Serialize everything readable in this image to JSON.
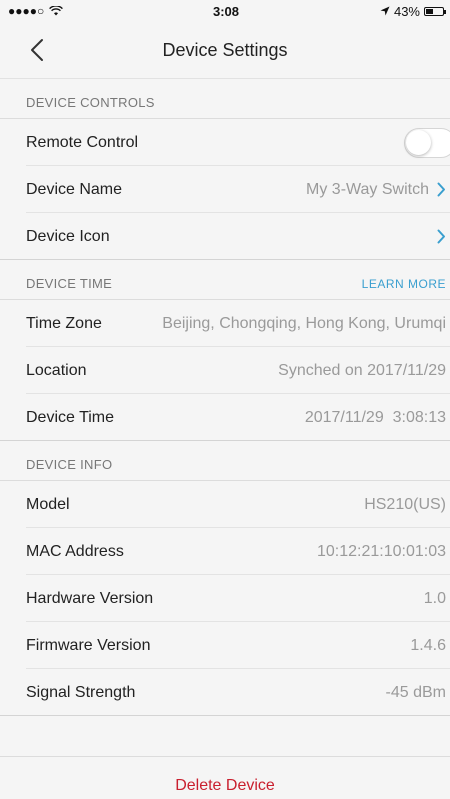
{
  "status_bar": {
    "signal": "●●●●○",
    "time": "3:08",
    "battery_percent": "43%",
    "battery_level": 0.43
  },
  "nav": {
    "title": "Device Settings"
  },
  "device_controls": {
    "header": "DEVICE CONTROLS",
    "remote_control": {
      "label": "Remote Control",
      "enabled": false
    },
    "device_name": {
      "label": "Device Name",
      "value": "My 3-Way Switch"
    },
    "device_icon": {
      "label": "Device Icon"
    }
  },
  "device_time": {
    "header": "DEVICE TIME",
    "learn_more": "LEARN MORE",
    "time_zone": {
      "label": "Time Zone",
      "value": "Beijing, Chongqing, Hong Kong, Urumqi"
    },
    "location": {
      "label": "Location",
      "value": "Synched on 2017/11/29"
    },
    "device_time": {
      "label": "Device Time",
      "value": "2017/11/29  3:08:13"
    }
  },
  "device_info": {
    "header": "DEVICE INFO",
    "model": {
      "label": "Model",
      "value": "HS210(US)"
    },
    "mac": {
      "label": "MAC Address",
      "value": "10:12:21:10:01:03"
    },
    "hardware": {
      "label": "Hardware Version",
      "value": "1.0"
    },
    "firmware": {
      "label": "Firmware Version",
      "value": "1.4.6"
    },
    "signal": {
      "label": "Signal Strength",
      "value": "-45 dBm"
    }
  },
  "actions": {
    "delete": "Delete Device"
  },
  "colors": {
    "accent": "#3a9fcf",
    "danger": "#c9202f",
    "background": "#f5f5f5"
  }
}
